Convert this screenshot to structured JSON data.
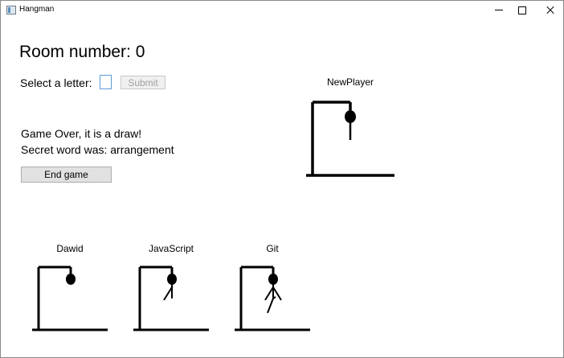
{
  "window": {
    "title": "Hangman",
    "app_icon": "app-window-icon",
    "controls": [
      "minimize-icon",
      "maximize-icon",
      "close-icon"
    ]
  },
  "room": {
    "title": "Room number: 0"
  },
  "guess": {
    "label": "Select a letter:",
    "input_value": "",
    "submit_label": "Submit",
    "submit_enabled": false
  },
  "status": {
    "line1": "Game Over, it is a draw!",
    "line2": "Secret word was: arrangement"
  },
  "actions": {
    "end_game_label": "End game"
  },
  "players": {
    "main": {
      "name": "NewPlayer",
      "stage": 2
    },
    "others": [
      {
        "name": "Dawid",
        "stage": 1
      },
      {
        "name": "JavaScript",
        "stage": 3
      },
      {
        "name": "Git",
        "stage": 6
      }
    ]
  }
}
